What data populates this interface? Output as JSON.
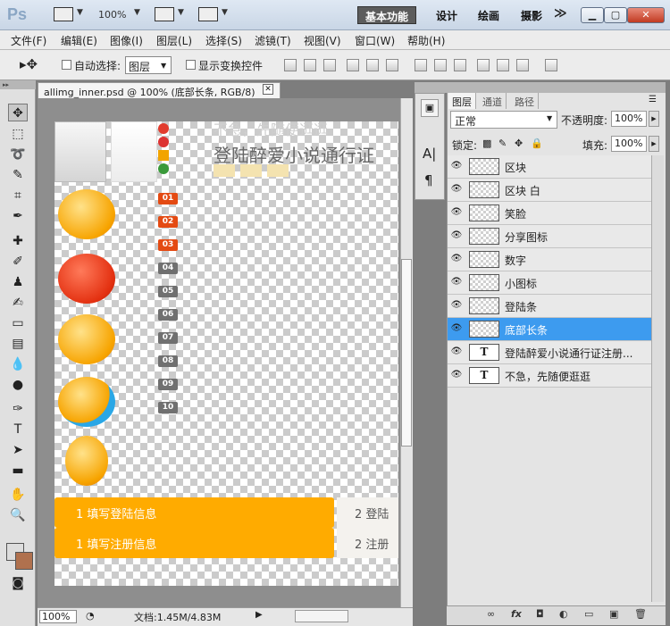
{
  "app": {
    "logo": "Ps",
    "zoom": "100%"
  },
  "workspaces": {
    "active": "基本功能",
    "design": "设计",
    "paint": "绘画",
    "photo": "摄影",
    "more": "≫"
  },
  "menu": [
    "文件(F)",
    "编辑(E)",
    "图像(I)",
    "图层(L)",
    "选择(S)",
    "滤镜(T)",
    "视图(V)",
    "窗口(W)",
    "帮助(H)"
  ],
  "options": {
    "auto_select": "自动选择:",
    "target": "图层",
    "show_transform": "显示变换控件"
  },
  "document": {
    "tab": "allimg_inner.psd @ 100% (底部长条, RGB/8)",
    "zoom": "100%",
    "info": "文档:1.45M/4.83M"
  },
  "canvas": {
    "text_top": "不急，先随便逛逛",
    "title": "登陆醉爱小说通行证",
    "numbers": [
      "01",
      "02",
      "03",
      "04",
      "05",
      "06",
      "07",
      "08",
      "09",
      "10"
    ],
    "bar1_left": "1 填写登陆信息",
    "bar1_right": "2 登陆",
    "bar2_left": "1 填写注册信息",
    "bar2_right": "2 注册"
  },
  "panel": {
    "tabs": [
      "图层",
      "通道",
      "路径"
    ],
    "blend": "正常",
    "opacity_label": "不透明度:",
    "opacity": "100%",
    "lock_label": "锁定:",
    "fill_label": "填充:",
    "fill": "100%"
  },
  "layers": [
    {
      "name": "区块",
      "type": "img"
    },
    {
      "name": "区块 白",
      "type": "img"
    },
    {
      "name": "笑脸",
      "type": "img"
    },
    {
      "name": "分享图标",
      "type": "img"
    },
    {
      "name": "数字",
      "type": "img"
    },
    {
      "name": "小图标",
      "type": "img"
    },
    {
      "name": "登陆条",
      "type": "img"
    },
    {
      "name": "底部长条",
      "type": "img",
      "selected": true
    },
    {
      "name": "登陆醉爱小说通行证注册...",
      "type": "text"
    },
    {
      "name": "不急，先随便逛逛",
      "type": "text"
    }
  ],
  "colors": {
    "accent": "#3d9bef",
    "orange": "#ffab00",
    "red_tag": "#e44a12"
  }
}
